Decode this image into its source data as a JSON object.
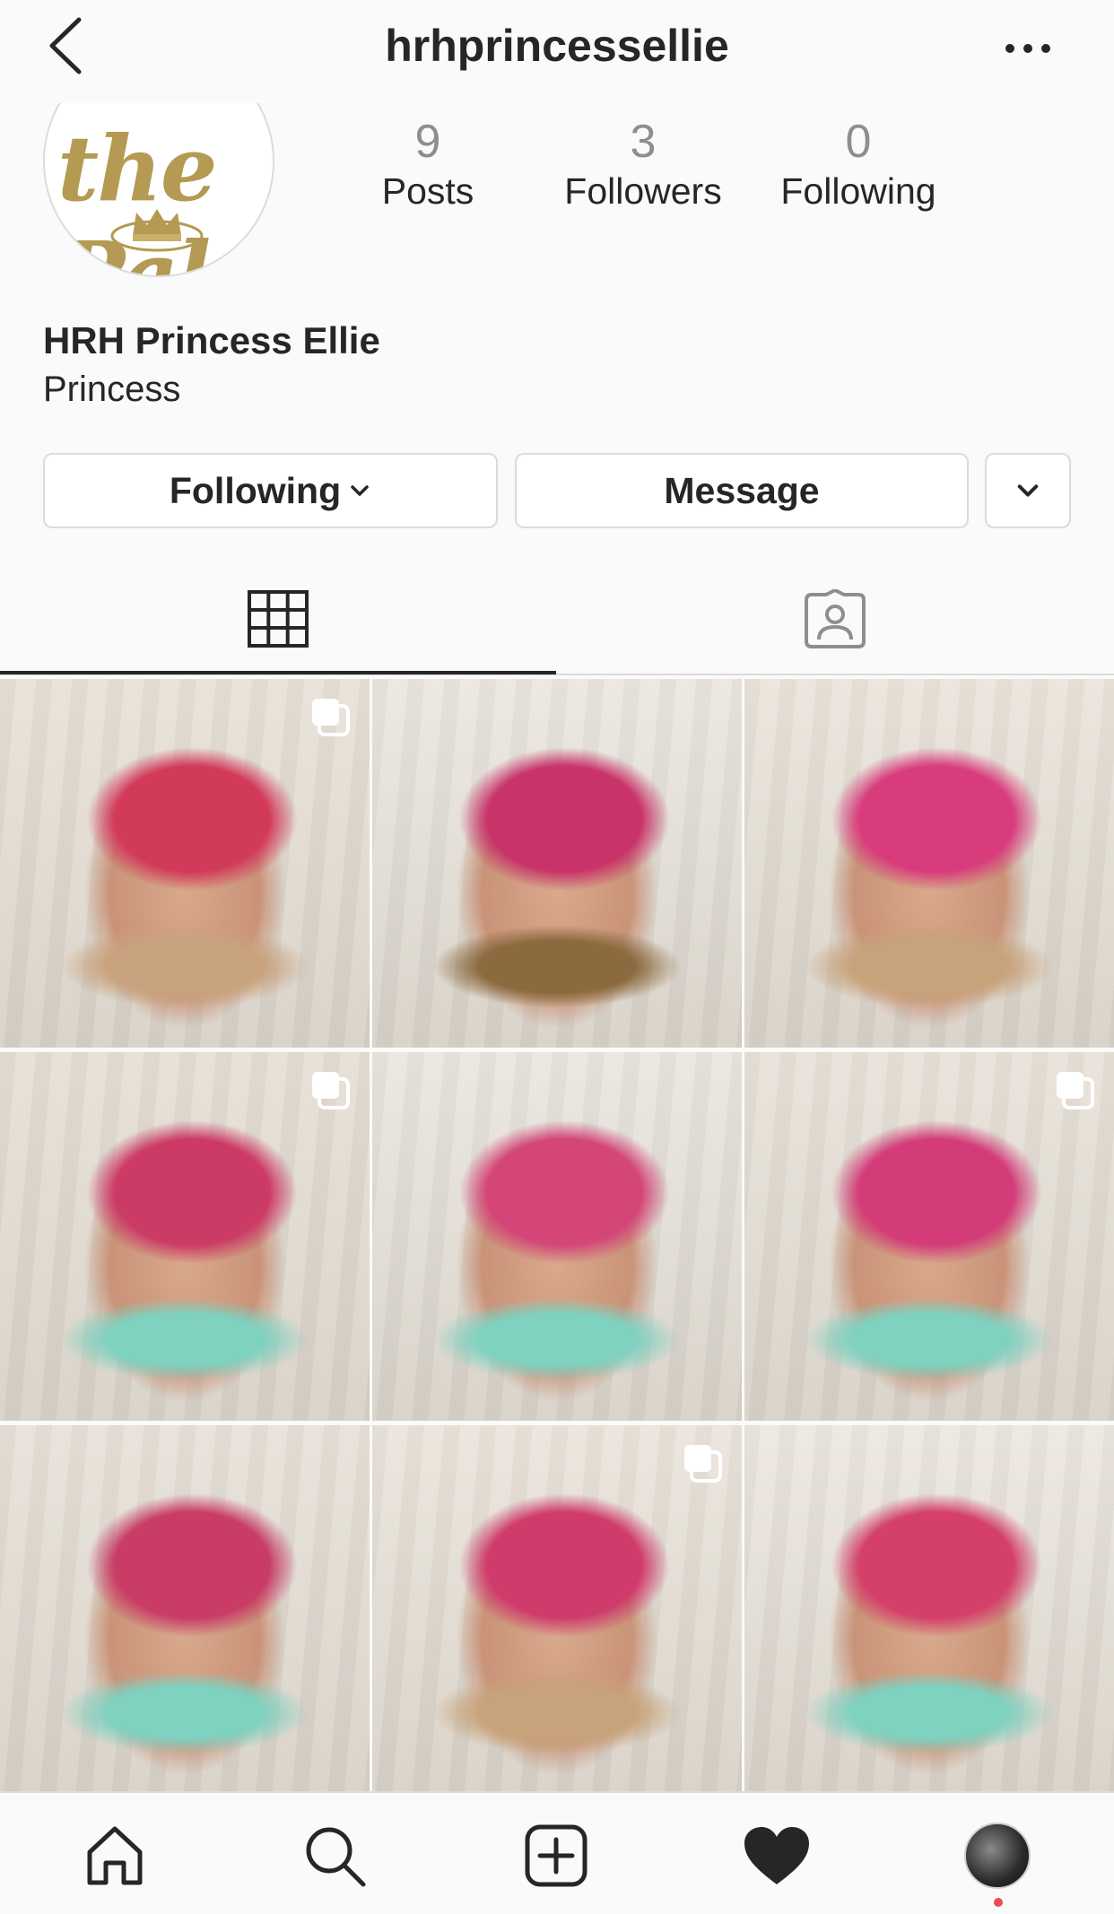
{
  "header": {
    "username": "hrhprincessellie",
    "back_icon": "chevron-left-icon",
    "more_icon": "ellipsis-icon"
  },
  "avatar": {
    "logo_text": "the Palace",
    "logo_color": "#b49a52"
  },
  "stats": [
    {
      "value": "9",
      "label": "Posts"
    },
    {
      "value": "3",
      "label": "Followers"
    },
    {
      "value": "0",
      "label": "Following"
    }
  ],
  "profile": {
    "display_name": "HRH Princess Ellie",
    "bio": "Princess"
  },
  "actions": {
    "following_label": "Following",
    "message_label": "Message"
  },
  "tabs": [
    {
      "name": "grid",
      "icon": "grid-icon",
      "active": true
    },
    {
      "name": "tagged",
      "icon": "tagged-person-icon",
      "active": false
    }
  ],
  "posts": [
    {
      "multi": true,
      "palette": [
        "#e9e2d8",
        "#d23a5a",
        "#c9a27e"
      ]
    },
    {
      "multi": false,
      "palette": [
        "#ece8e1",
        "#c8346a",
        "#8b6a3f"
      ]
    },
    {
      "multi": false,
      "palette": [
        "#ebe5dc",
        "#d83c7c",
        "#c8a27a"
      ]
    },
    {
      "multi": true,
      "palette": [
        "#e7e0d6",
        "#cc3a66",
        "#7fd1c0"
      ]
    },
    {
      "multi": false,
      "palette": [
        "#ebe7e0",
        "#d44578",
        "#7fd1c0"
      ]
    },
    {
      "multi": true,
      "palette": [
        "#e9e3da",
        "#d33c78",
        "#7fd1c0"
      ]
    },
    {
      "multi": false,
      "palette": [
        "#e8e2d9",
        "#c83c66",
        "#7fd1c0"
      ]
    },
    {
      "multi": true,
      "palette": [
        "#ebe5dc",
        "#cf3c6c",
        "#c8a27a"
      ]
    },
    {
      "multi": false,
      "palette": [
        "#ede8e0",
        "#d4406a",
        "#7fd1c0"
      ]
    }
  ],
  "bottom_nav": [
    {
      "name": "home",
      "icon": "home-icon"
    },
    {
      "name": "search",
      "icon": "search-icon"
    },
    {
      "name": "new-post",
      "icon": "add-post-icon"
    },
    {
      "name": "activity",
      "icon": "heart-icon"
    },
    {
      "name": "profile",
      "icon": "profile-avatar"
    }
  ],
  "colors": {
    "text": "#262626",
    "secondary": "#8e8e8e",
    "border": "#dbdbdb",
    "notification": "#ed4956"
  }
}
